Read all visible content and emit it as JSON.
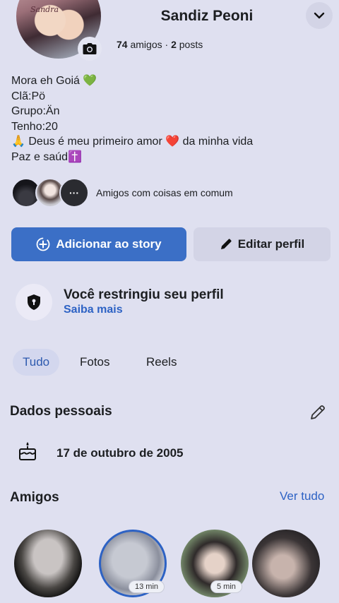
{
  "profile": {
    "name": "Sandiz Peoni",
    "picture_caption": "Sandra",
    "friends_count": "74",
    "friends_label": "amigos",
    "separator": "·",
    "posts_count": "2",
    "posts_label": "posts"
  },
  "bio": {
    "lines": [
      "Mora eh Goiá 💚",
      "Clã:Pö",
      "Grupo:Än",
      "Tenho:20",
      "🙏 Deus é meu primeiro amor ❤️ da minha vida",
      "Paz e saúd✝️"
    ]
  },
  "mutual": {
    "more_label": "···",
    "label": "Amigos com coisas em comum"
  },
  "actions": {
    "story_label": "Adicionar ao story",
    "edit_label": "Editar perfil"
  },
  "restriction": {
    "title": "Você restringiu seu perfil",
    "link": "Saiba mais"
  },
  "tabs": [
    {
      "label": "Tudo",
      "active": true
    },
    {
      "label": "Fotos",
      "active": false
    },
    {
      "label": "Reels",
      "active": false
    }
  ],
  "personal": {
    "title": "Dados pessoais",
    "birthday": "17 de outubro de 2005"
  },
  "friends": {
    "title": "Amigos",
    "see_all": "Ver tudo",
    "items": [
      {
        "badge": ""
      },
      {
        "badge": "13 min"
      },
      {
        "badge": "5 min"
      },
      {
        "badge": ""
      }
    ]
  },
  "colors": {
    "background": "#dfe0f0",
    "primary": "#3b6fc6",
    "link": "#2d62c4"
  },
  "icons": [
    "camera-icon",
    "chevron-down-icon",
    "add-story-icon",
    "pencil-icon",
    "shield-icon",
    "edit-pencil-icon",
    "birthday-cake-icon"
  ]
}
